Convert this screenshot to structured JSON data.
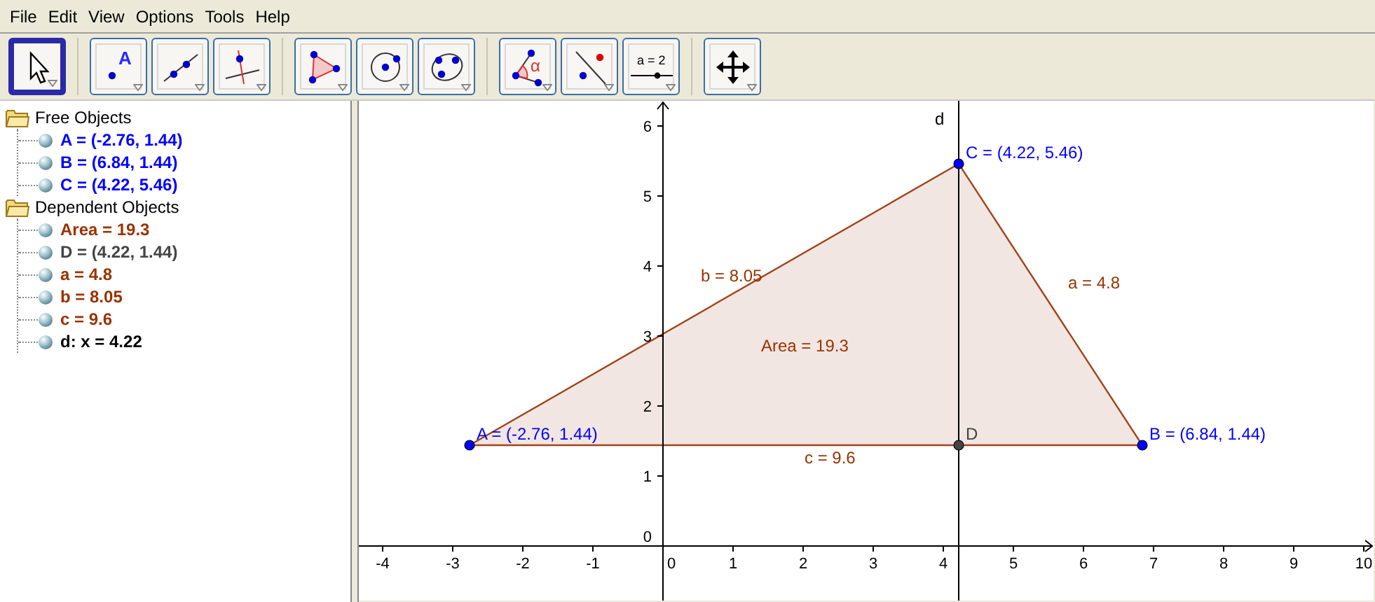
{
  "menu": [
    "File",
    "Edit",
    "View",
    "Options",
    "Tools",
    "Help"
  ],
  "toolbar": {
    "groups": [
      [
        {
          "kind": "move",
          "selected": true
        }
      ],
      [
        {
          "kind": "point",
          "selected": false,
          "label": "A"
        },
        {
          "kind": "line",
          "selected": false
        },
        {
          "kind": "perpendicular",
          "selected": false
        }
      ],
      [
        {
          "kind": "polygon",
          "selected": false
        },
        {
          "kind": "circle",
          "selected": false
        },
        {
          "kind": "conic",
          "selected": false
        }
      ],
      [
        {
          "kind": "angle",
          "selected": false,
          "label": "α"
        },
        {
          "kind": "reflect",
          "selected": false
        },
        {
          "kind": "slider",
          "selected": false,
          "label": "a = 2"
        }
      ],
      [
        {
          "kind": "move-view",
          "selected": false
        }
      ]
    ]
  },
  "algebra": {
    "folders": [
      {
        "label": "Free Objects",
        "expanded": true,
        "children": [
          {
            "text": "A = (-2.76, 1.44)",
            "color": "#0000ff"
          },
          {
            "text": "B = (6.84, 1.44)",
            "color": "#0000ff"
          },
          {
            "text": "C = (4.22, 5.46)",
            "color": "#0000ff"
          }
        ]
      },
      {
        "label": "Dependent Objects",
        "expanded": true,
        "children": [
          {
            "text": "Area = 19.3",
            "color": "#993300"
          },
          {
            "text": "D = (4.22, 1.44)",
            "color": "#444444"
          },
          {
            "text": "a = 4.8",
            "color": "#993300"
          },
          {
            "text": "b = 8.05",
            "color": "#993300"
          },
          {
            "text": "c = 9.6",
            "color": "#993300"
          },
          {
            "text": "d: x = 4.22",
            "color": "#000000"
          }
        ]
      }
    ]
  },
  "graphics": {
    "chart_data": {
      "type": "scatter",
      "xlim": [
        -4.34,
        10.14
      ],
      "ylim": [
        -0.78,
        6.36
      ],
      "xticks": [
        -4,
        -3,
        -2,
        -1,
        0,
        1,
        2,
        3,
        4,
        5,
        6,
        7,
        8,
        9,
        10
      ],
      "yticks": [
        0,
        1,
        2,
        3,
        4,
        5,
        6
      ],
      "x": [
        -2.76,
        6.84,
        4.22,
        4.22
      ],
      "series": [
        {
          "color": "#0000ff",
          "values": [
            1.44,
            1.44,
            5.46,
            null
          ]
        },
        {
          "color": "#444444",
          "values": [
            null,
            null,
            null,
            1.44
          ]
        }
      ]
    },
    "labels": [
      {
        "text": "A = (-2.76, 1.44)",
        "color": "#0000ff"
      },
      {
        "text": "B = (6.84, 1.44)",
        "color": "#0000ff"
      },
      {
        "text": "C = (4.22, 5.46)",
        "color": "#0000ff"
      },
      {
        "text": "D",
        "color": "#444444"
      },
      {
        "text": "d",
        "color": "#000000"
      },
      {
        "text": "b = 8.05",
        "color": "#993300"
      },
      {
        "text": "Area = 19.3",
        "color": "#993300"
      },
      {
        "text": "a = 4.8",
        "color": "#993300"
      },
      {
        "text": "c = 9.6",
        "color": "#993300"
      }
    ]
  }
}
